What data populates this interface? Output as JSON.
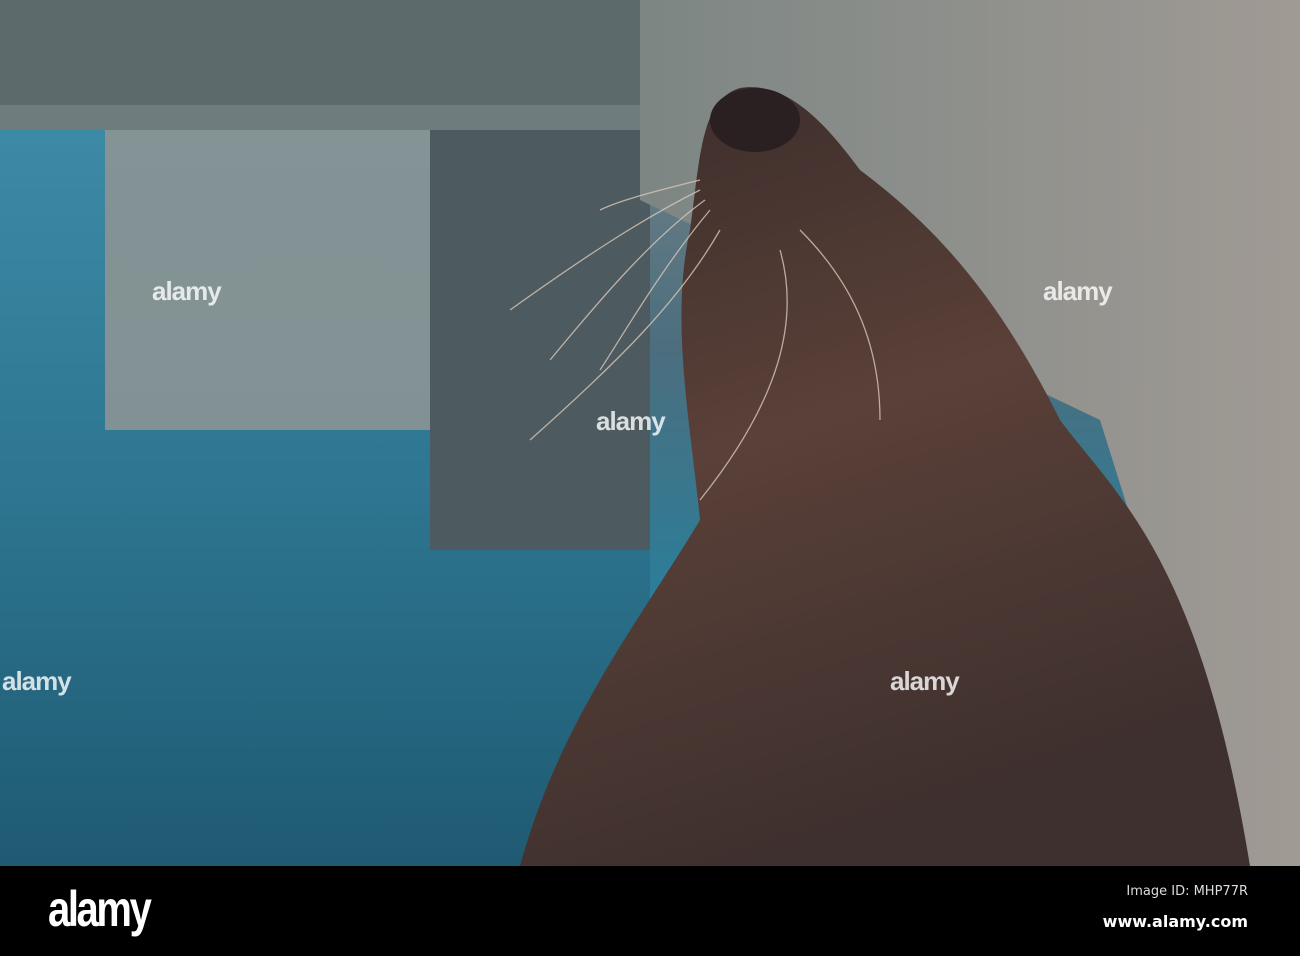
{
  "photo": {
    "subject": "sea-lion",
    "watermark_text": "alamy",
    "colors": {
      "water": "#2a7e9a",
      "wall": "#8a8e8c",
      "fur": "#4a3530",
      "bar": "#000000"
    }
  },
  "footer": {
    "logo": "alamy",
    "image_id": "Image ID: MHP77R",
    "url": "www.alamy.com"
  }
}
